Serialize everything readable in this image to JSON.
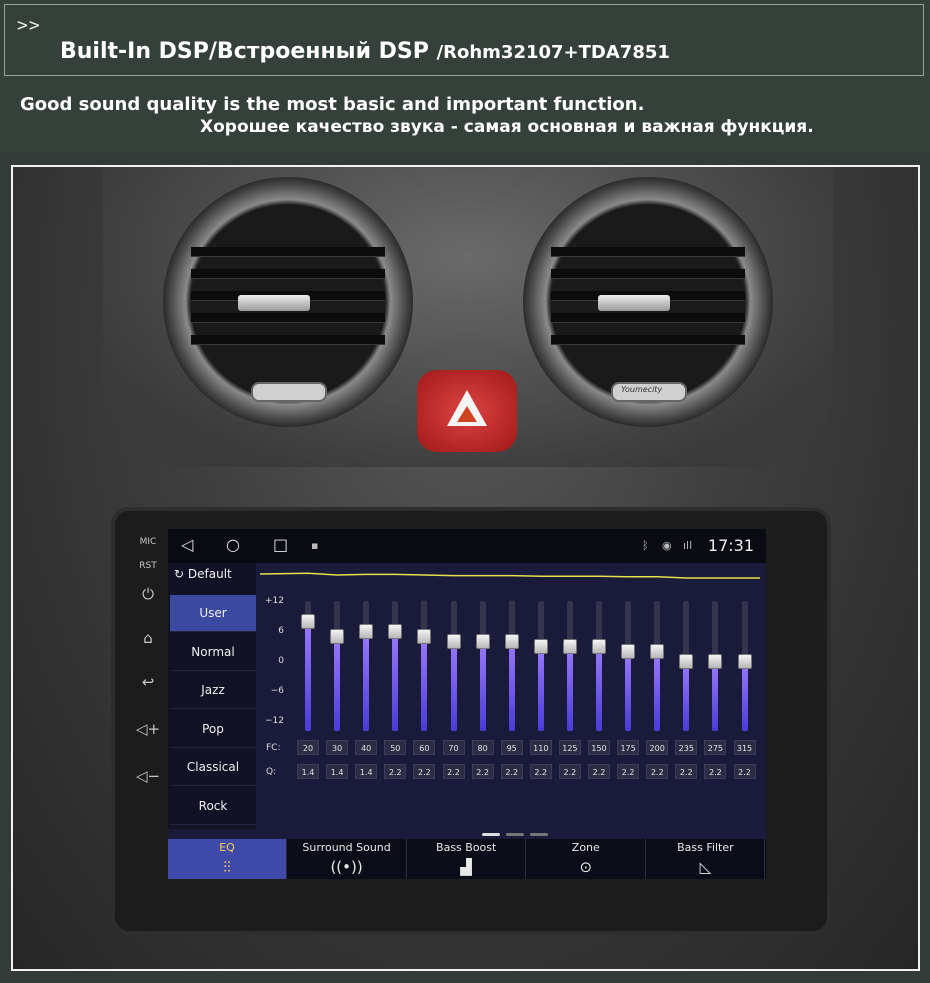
{
  "header": {
    "arrows": ">>",
    "title_main": "Built-In DSP/Встроенный DSP",
    "title_sub": "/Rohm32107+TDA7851",
    "line_en": "Good sound quality is the most basic and important function.",
    "line_ru": "Хорошее качество звука - самая основная и важная функция."
  },
  "watermark": "Youmecity",
  "side_keys": [
    {
      "label": "MIC",
      "icon": "mic-hole-icon"
    },
    {
      "label": "RST",
      "icon": "reset-hole-icon"
    },
    {
      "label": "",
      "icon": "power-icon",
      "glyph": "⏻"
    },
    {
      "label": "",
      "icon": "home-icon",
      "glyph": "⌂"
    },
    {
      "label": "",
      "icon": "back-icon",
      "glyph": "↩"
    },
    {
      "label": "",
      "icon": "volume-up-icon",
      "glyph": "◁+"
    },
    {
      "label": "",
      "icon": "volume-down-icon",
      "glyph": "◁−"
    }
  ],
  "status_bar": {
    "time": "17:31",
    "nav_back": "◁",
    "nav_home": "○",
    "nav_recent": "□",
    "gallery": "▪",
    "bluetooth": "ᛒ",
    "location": "◉",
    "signal": "ıll"
  },
  "presets": {
    "default_label": "Default",
    "reset_glyph": "↻",
    "items": [
      "User",
      "Normal",
      "Jazz",
      "Pop",
      "Classical",
      "Rock"
    ],
    "selected": "User"
  },
  "eq": {
    "y_ticks": [
      "+12",
      "6",
      "0",
      "−6",
      "−12"
    ],
    "fc_label": "FC:",
    "q_label": "Q:",
    "bands": [
      {
        "fc": "20",
        "q": "1.4",
        "gain": 8
      },
      {
        "fc": "30",
        "q": "1.4",
        "gain": 5
      },
      {
        "fc": "40",
        "q": "1.4",
        "gain": 6
      },
      {
        "fc": "50",
        "q": "2.2",
        "gain": 6
      },
      {
        "fc": "60",
        "q": "2.2",
        "gain": 5
      },
      {
        "fc": "70",
        "q": "2.2",
        "gain": 4
      },
      {
        "fc": "80",
        "q": "2.2",
        "gain": 4
      },
      {
        "fc": "95",
        "q": "2.2",
        "gain": 4
      },
      {
        "fc": "110",
        "q": "2.2",
        "gain": 3
      },
      {
        "fc": "125",
        "q": "2.2",
        "gain": 3
      },
      {
        "fc": "150",
        "q": "2.2",
        "gain": 3
      },
      {
        "fc": "175",
        "q": "2.2",
        "gain": 2
      },
      {
        "fc": "200",
        "q": "2.2",
        "gain": 2
      },
      {
        "fc": "235",
        "q": "2.2",
        "gain": 0
      },
      {
        "fc": "275",
        "q": "2.2",
        "gain": 0
      },
      {
        "fc": "315",
        "q": "2.2",
        "gain": 0
      }
    ],
    "fill_color": "#6a55f0",
    "curve_color": "#e6e04a",
    "page": 1,
    "pages": 3
  },
  "tabs": [
    {
      "label": "EQ",
      "icon": "equalizer-icon",
      "glyph": "⫶⫶"
    },
    {
      "label": "Surround Sound",
      "icon": "surround-icon",
      "glyph": "((•))"
    },
    {
      "label": "Bass Boost",
      "icon": "bass-boost-icon",
      "glyph": "▟"
    },
    {
      "label": "Zone",
      "icon": "zone-icon",
      "glyph": "⊙"
    },
    {
      "label": "Bass Filter",
      "icon": "bass-filter-icon",
      "glyph": "◺"
    }
  ],
  "selected_tab": "EQ"
}
